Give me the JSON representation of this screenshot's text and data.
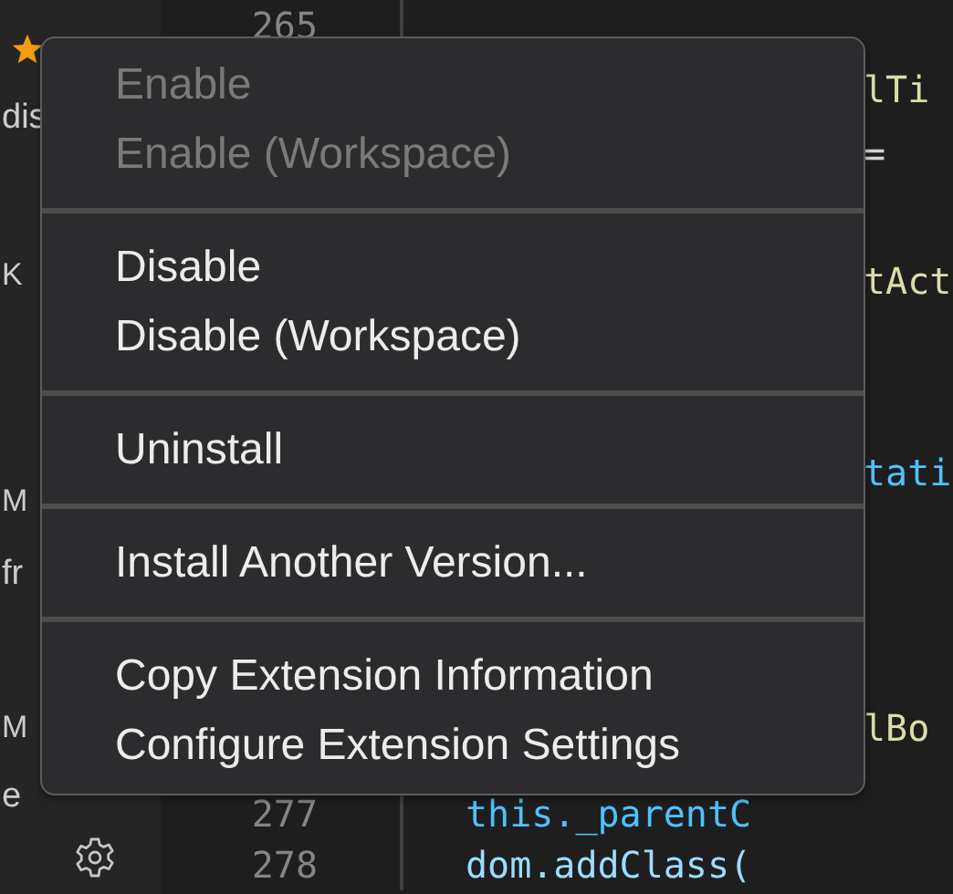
{
  "sidebar": {
    "fragments": [
      "dis",
      "K",
      "M",
      "fr",
      "M",
      "e"
    ]
  },
  "editor": {
    "lines": [
      {
        "number": "265"
      },
      {
        "code": "lTi"
      },
      {
        "code": "="
      },
      {
        "code": "tAct"
      },
      {
        "code": "tati"
      },
      {
        "code": "lBo"
      },
      {
        "number": "277",
        "code": "this._parentC"
      },
      {
        "number": "278",
        "code": "dom.addClass("
      }
    ]
  },
  "context_menu": {
    "groups": [
      [
        {
          "label": "Enable",
          "disabled": true
        },
        {
          "label": "Enable (Workspace)",
          "disabled": true
        }
      ],
      [
        {
          "label": "Disable",
          "disabled": false
        },
        {
          "label": "Disable (Workspace)",
          "disabled": false
        }
      ],
      [
        {
          "label": "Uninstall",
          "disabled": false
        }
      ],
      [
        {
          "label": "Install Another Version...",
          "disabled": false
        }
      ],
      [
        {
          "label": "Copy Extension Information",
          "disabled": false
        },
        {
          "label": "Configure Extension Settings",
          "disabled": false
        }
      ]
    ]
  }
}
